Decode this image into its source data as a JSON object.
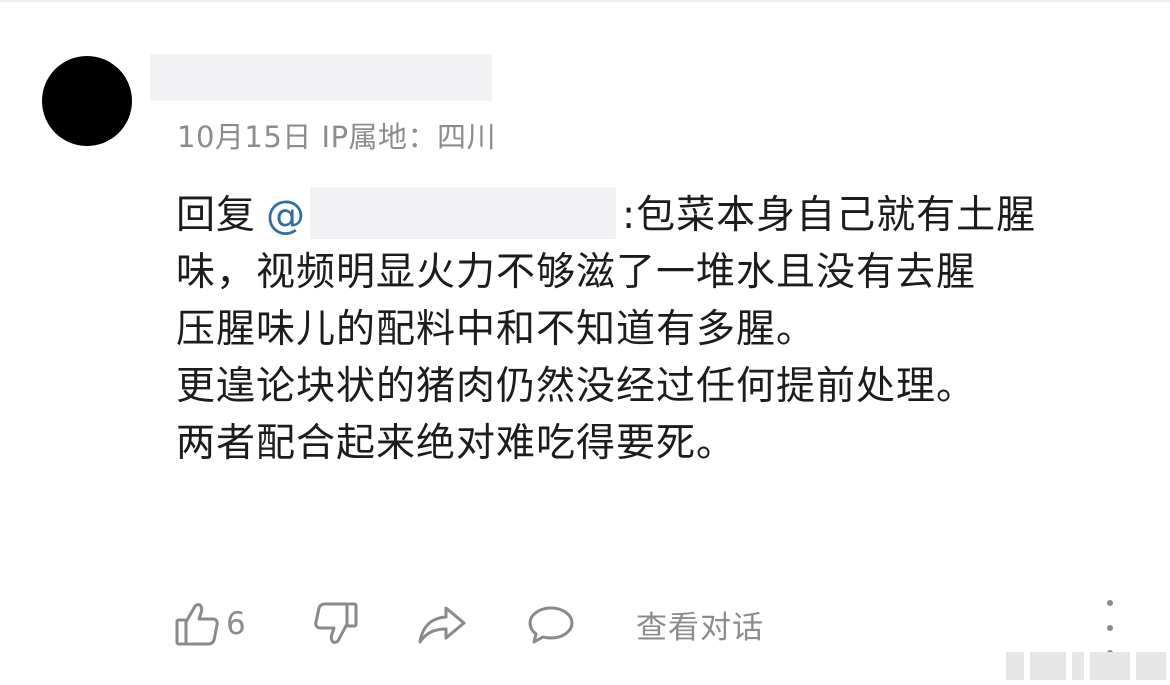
{
  "comment": {
    "meta": "10月15日  IP属地：四川",
    "reply_prefix": "回复",
    "mention_at": "@",
    "body_lines": [
      ":包菜本身自己就有土腥",
      "味，视频明显火力不够滋了一堆水且没有去腥",
      "压腥味儿的配料中和不知道有多腥。",
      "更遑论块状的猪肉仍然没经过任何提前处理。",
      "两者配合起来绝对难吃得要死。"
    ]
  },
  "actions": {
    "like_icon": "thumbs-up-icon",
    "like_count": "6",
    "dislike_icon": "thumbs-down-icon",
    "share_icon": "share-icon",
    "comment_icon": "comment-bubble-icon",
    "view_conversation": "查看对话",
    "more_icon": "more-vertical-icon"
  },
  "colors": {
    "meta_text": "#8c8c8c",
    "mention": "#2f6e9f",
    "body_text": "#1c1c1c"
  }
}
